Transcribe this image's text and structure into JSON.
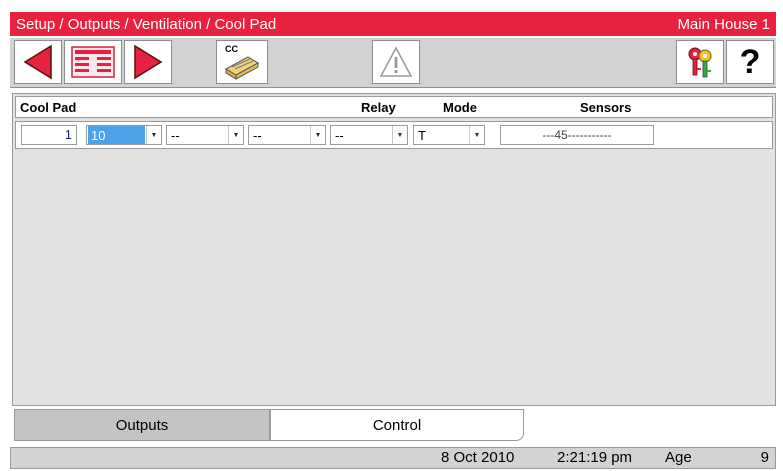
{
  "title": {
    "breadcrumb": "Setup / Outputs / Ventilation / Cool Pad",
    "location": "Main House 1"
  },
  "toolbar": {
    "cc_label": "CC",
    "help_label": "?"
  },
  "table": {
    "headers": {
      "name": "Cool Pad",
      "relay": "Relay",
      "mode": "Mode",
      "sensors": "Sensors"
    },
    "row": {
      "index": "1",
      "relays": [
        "10",
        "--",
        "--",
        "--",
        "--"
      ],
      "mode": "T",
      "sensors": "---45-----------"
    }
  },
  "tabs": {
    "outputs": "Outputs",
    "control": "Control"
  },
  "status": {
    "date": "8 Oct 2010",
    "time": "2:21:19 pm",
    "age_label": "Age",
    "age_value": "9"
  },
  "colors": {
    "title_bar": "#e8213f",
    "arrow_red": "#e8213f",
    "selected_cell": "#4aa3e8"
  }
}
